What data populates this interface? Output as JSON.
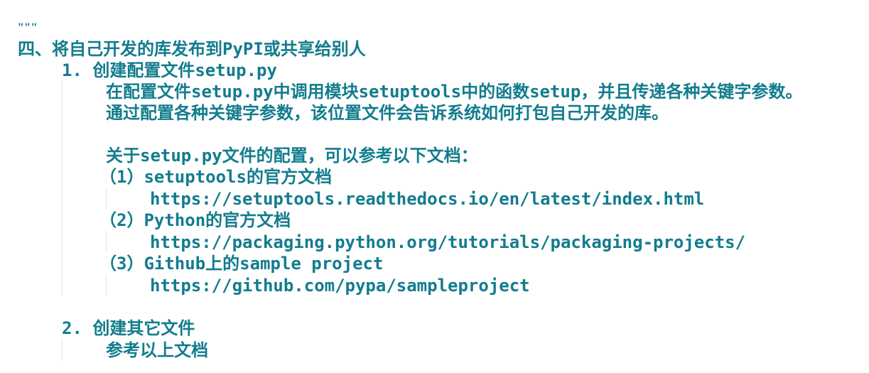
{
  "theme": {
    "text_color": "#127c8e",
    "background": "#ffffff",
    "indent_guide_color": "#e4e4e4"
  },
  "code": {
    "docstring_open": "\"\"\"",
    "heading": "四、将自己开发的库发布到PyPI或共享给别人",
    "step1_title": "1. 创建配置文件setup.py",
    "step1_line1": "在配置文件setup.py中调用模块setuptools中的函数setup，并且传递各种关键字参数。",
    "step1_line2": "通过配置各种关键字参数，该位置文件会告诉系统如何打包自己开发的库。",
    "ref_intro": "关于setup.py文件的配置，可以参考以下文档：",
    "ref1_title": "（1）setuptools的官方文档",
    "ref1_url": "https://setuptools.readthedocs.io/en/latest/index.html",
    "ref2_title": "（2）Python的官方文档",
    "ref2_url": "https://packaging.python.org/tutorials/packaging-projects/",
    "ref3_title": "（3）Github上的sample project",
    "ref3_url": "https://github.com/pypa/sampleproject",
    "step2_title": "2. 创建其它文件",
    "step2_line1": "参考以上文档"
  }
}
